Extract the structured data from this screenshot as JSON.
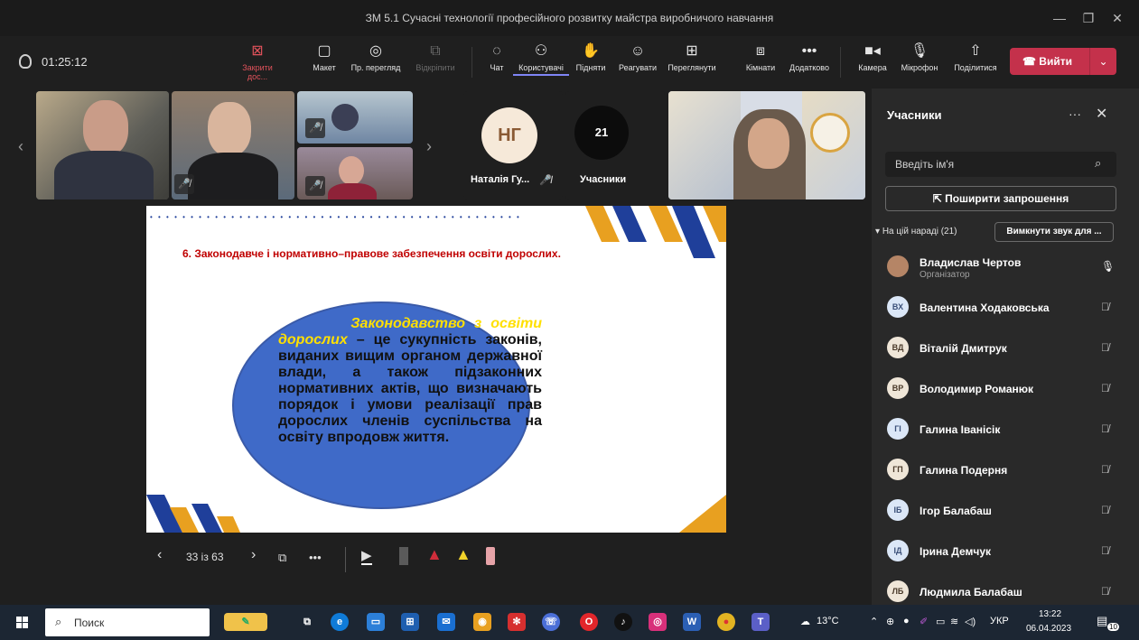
{
  "window": {
    "title": "ЗМ 5.1 Сучасні технології професійного розвитку майстра виробничого навчання"
  },
  "toolbar": {
    "timer": "01:25:12",
    "buttons": [
      {
        "id": "close-share",
        "label": "Закрити дос...",
        "icon": "close-square-icon"
      },
      {
        "id": "layout",
        "label": "Макет",
        "icon": "layout-icon"
      },
      {
        "id": "preview",
        "label": "Пр. перегляд",
        "icon": "eye-icon"
      },
      {
        "id": "popout",
        "label": "Відкріпити",
        "icon": "popout-icon"
      },
      {
        "id": "chat",
        "label": "Чат",
        "icon": "chat-icon"
      },
      {
        "id": "people",
        "label": "Користувачі",
        "icon": "people-icon"
      },
      {
        "id": "raise",
        "label": "Підняти",
        "icon": "hand-icon"
      },
      {
        "id": "react",
        "label": "Реагувати",
        "icon": "smiley-icon"
      },
      {
        "id": "view",
        "label": "Переглянути",
        "icon": "grid-icon"
      },
      {
        "id": "rooms",
        "label": "Кімнати",
        "icon": "rooms-icon"
      },
      {
        "id": "more",
        "label": "Додатково",
        "icon": "more-icon"
      },
      {
        "id": "camera",
        "label": "Камера",
        "icon": "camera-icon"
      },
      {
        "id": "mic",
        "label": "Мікрофон",
        "icon": "mic-icon"
      },
      {
        "id": "share",
        "label": "Поділитися",
        "icon": "share-icon"
      }
    ],
    "leave_label": "Вийти"
  },
  "stage": {
    "initials_tile": {
      "initials": "НГ",
      "name": "Наталія Гу..."
    },
    "count_tile": {
      "count": "21",
      "label": "Учасники"
    }
  },
  "slide": {
    "heading": "6.  Законодавче і нормативно–правове забезпечення освіти дорослих.",
    "term": "Законодавство з освіти дорослих",
    "definition": " – це сукупність законів, виданих вищим органом державної влади, а також підзаконних нормативних актів, що визначають порядок і умови реалізації прав дорослих членів суспільства на освіту впродовж життя."
  },
  "slide_controls": {
    "page": "33 із 63"
  },
  "panel": {
    "title": "Учасники",
    "search_placeholder": "Введіть ім'я",
    "invite_label": "Поширити запрошення",
    "section_label": "На цій нараді (21)",
    "mute_all_label": "Вимкнути звук для ...",
    "participants": [
      {
        "initials": "",
        "name": "Владислав Чертов",
        "role": "Організатор",
        "mic": "on"
      },
      {
        "initials": "ВХ",
        "name": "Валентина Ходаковська",
        "role": "",
        "mic": "off"
      },
      {
        "initials": "ВД",
        "name": "Віталій Дмитрук",
        "role": "",
        "mic": "off"
      },
      {
        "initials": "ВР",
        "name": "Володимир Романюк",
        "role": "",
        "mic": "off"
      },
      {
        "initials": "ГІ",
        "name": "Галина Іванісік",
        "role": "",
        "mic": "off"
      },
      {
        "initials": "ГП",
        "name": "Галина Подерня",
        "role": "",
        "mic": "off"
      },
      {
        "initials": "ІБ",
        "name": "Ігор Балабаш",
        "role": "",
        "mic": "off"
      },
      {
        "initials": "ІД",
        "name": "Ірина Демчук",
        "role": "",
        "mic": "off"
      },
      {
        "initials": "ЛБ",
        "name": "Людмила Балабаш",
        "role": "",
        "mic": "off"
      }
    ]
  },
  "taskbar": {
    "search_placeholder": "Поиск",
    "weather": "13°C",
    "lang": "УКР",
    "time": "13:22",
    "date": "06.04.2023",
    "notifications": "10"
  },
  "colors": {
    "leave": "#c4314b",
    "accent": "#7f85f5",
    "slide_red": "#c00000",
    "ellipse": "#3f6ac8",
    "term_yellow": "#ffe000"
  }
}
